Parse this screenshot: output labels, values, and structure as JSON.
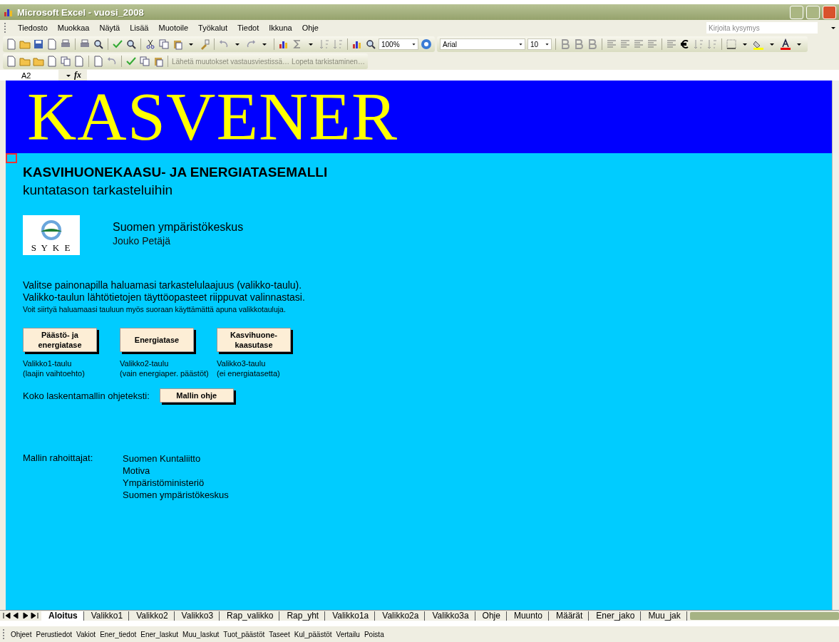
{
  "window": {
    "title": "Microsoft Excel - vuosi_2008"
  },
  "menu": [
    {
      "label": "Tiedosto"
    },
    {
      "label": "Muokkaa"
    },
    {
      "label": "Näytä"
    },
    {
      "label": "Lisää"
    },
    {
      "label": "Muotoile"
    },
    {
      "label": "Työkalut"
    },
    {
      "label": "Tiedot"
    },
    {
      "label": "Ikkuna"
    },
    {
      "label": "Ohje"
    }
  ],
  "help_search": {
    "placeholder": "Kirjoita kysymys"
  },
  "toolbar": {
    "zoom": "100%",
    "font": "Arial",
    "font_size": "10"
  },
  "review_toolbar": {
    "send_reply": "Lähetä muutokset vastausviestissä…",
    "end_review": "Lopeta tarkistaminen…"
  },
  "formula_bar": {
    "name_box": "A2",
    "fx": "fx"
  },
  "sheet": {
    "banner": "KASVENER",
    "title": "KASVIHUONEKAASU- JA  ENERGIATASEMALLI",
    "subtitle": "kuntatason  tarkasteluihin",
    "logo_text": "S Y K E",
    "organization": "Suomen ympäristökeskus",
    "author": "Jouko Petäjä",
    "instructions": [
      {
        "text": "Valitse painonapilla haluamasi tarkastelulaajuus (valikko-taulu).",
        "kind": "large"
      },
      {
        "text": "Valikko-taulun lähtötietojen täyttöopasteet riippuvat valinnastasi.",
        "kind": "large"
      },
      {
        "text": "Voit siirtyä haluamaasi tauluun myös suoraan käyttämättä apuna valikkotauluja.",
        "kind": "small"
      }
    ],
    "menu_buttons": [
      {
        "label": [
          "Päästö- ja",
          "energiatase"
        ],
        "caption": [
          "Valikko1-taulu",
          "(laajin vaihtoehto)"
        ]
      },
      {
        "label": [
          "Energiatase"
        ],
        "caption": [
          "Valikko2-taulu",
          "(vain energiaper. päästöt)"
        ]
      },
      {
        "label": [
          "Kasvihuone-",
          "kaasutase"
        ],
        "caption": [
          "Valikko3-taulu",
          "(ei energiatasetta)"
        ]
      }
    ],
    "help_label": "Koko laskentamallin ohjeteksti:",
    "help_button": "Mallin ohje",
    "funders_label": "Mallin rahoittajat:",
    "funders": [
      "Suomen Kuntaliitto",
      "Motiva",
      "Ympäristöministeriö",
      "Suomen ympäristökeskus"
    ]
  },
  "sheet_tabs": [
    {
      "label": "Aloitus",
      "selected": true
    },
    {
      "label": "Valikko1",
      "selected": false
    },
    {
      "label": "Valikko2",
      "selected": false
    },
    {
      "label": "Valikko3",
      "selected": false
    },
    {
      "label": "Rap_valikko",
      "selected": false
    },
    {
      "label": "Rap_yht",
      "selected": false
    },
    {
      "label": "Valikko1a",
      "selected": false
    },
    {
      "label": "Valikko2a",
      "selected": false
    },
    {
      "label": "Valikko3a",
      "selected": false
    },
    {
      "label": "Ohje",
      "selected": false
    },
    {
      "label": "Muunto",
      "selected": false
    },
    {
      "label": "Määrät",
      "selected": false
    },
    {
      "label": "Ener_jako",
      "selected": false
    },
    {
      "label": "Muu_jak",
      "selected": false
    }
  ],
  "macro_toolbar": [
    "Ohjeet",
    "Perustiedot",
    "Vakiot",
    "Ener_tiedot",
    "Ener_laskut",
    "Muu_laskut",
    "Tuot_päästöt",
    "Taseet",
    "Kul_päästöt",
    "Vertailu",
    "Poista"
  ]
}
